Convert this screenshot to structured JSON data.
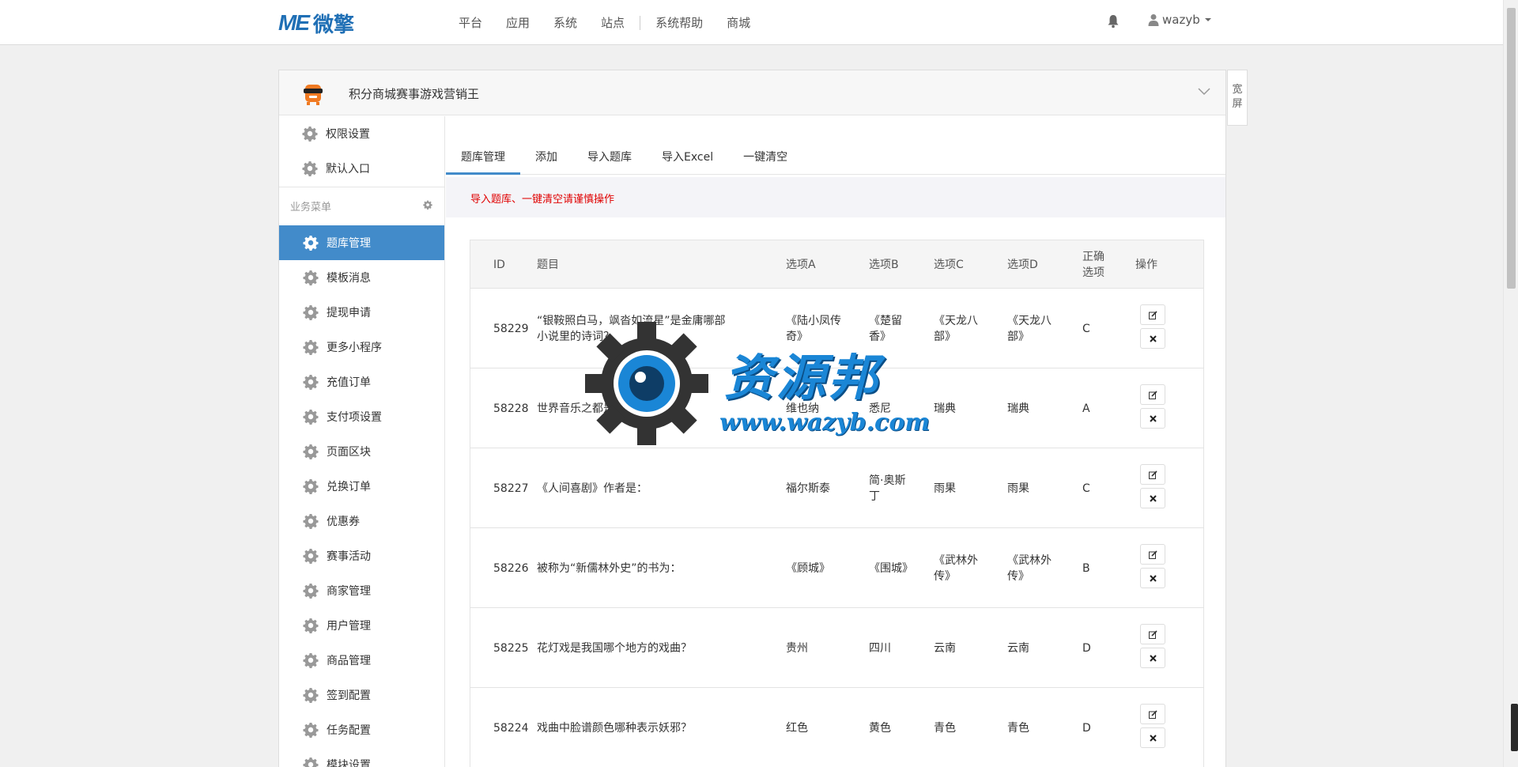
{
  "brand": {
    "logo_mark": "ME",
    "logo_text": "微擎"
  },
  "nav": {
    "items": [
      "平台",
      "应用",
      "系统",
      "站点",
      "系统帮助",
      "商城"
    ]
  },
  "user": {
    "name": "wazyb"
  },
  "app": {
    "title": "积分商城赛事游戏营销王"
  },
  "wide_button": {
    "label": "宽屏"
  },
  "sidebar": {
    "top_items": [
      "权限设置",
      "默认入口"
    ],
    "group_label": "业务菜单",
    "items": [
      "题库管理",
      "模板消息",
      "提现申请",
      "更多小程序",
      "充值订单",
      "支付项设置",
      "页面区块",
      "兑换订单",
      "优惠券",
      "赛事活动",
      "商家管理",
      "用户管理",
      "商品管理",
      "签到配置",
      "任务配置",
      "模块设置"
    ],
    "active_index": 0
  },
  "tabs": [
    "题库管理",
    "添加",
    "导入题库",
    "导入Excel",
    "一键清空"
  ],
  "notice": "导入题库、一键清空请谨慎操作",
  "table": {
    "headers": {
      "id": "ID",
      "question": "题目",
      "a": "选项A",
      "b": "选项B",
      "c": "选项C",
      "d": "选项D",
      "right": "正确选项",
      "ops": "操作"
    },
    "rows": [
      {
        "id": "58229",
        "question": "“银鞍照白马，飒沓如流星”是金庸哪部小说里的诗词？",
        "a": "《陆小凤传奇》",
        "b": "《楚留香》",
        "c": "《天龙八部》",
        "d": "《天龙八部》",
        "right": "C"
      },
      {
        "id": "58228",
        "question": "世界音乐之都是：",
        "a": "维也纳",
        "b": "悉尼",
        "c": "瑞典",
        "d": "瑞典",
        "right": "A"
      },
      {
        "id": "58227",
        "question": "《人间喜剧》作者是：",
        "a": "福尔斯泰",
        "b": "简·奥斯丁",
        "c": "雨果",
        "d": "雨果",
        "right": "C"
      },
      {
        "id": "58226",
        "question": "被称为“新儒林外史”的书为：",
        "a": "《顾城》",
        "b": "《围城》",
        "c": "《武林外传》",
        "d": "《武林外传》",
        "right": "B"
      },
      {
        "id": "58225",
        "question": "花灯戏是我国哪个地方的戏曲？",
        "a": "贵州",
        "b": "四川",
        "c": "云南",
        "d": "云南",
        "right": "D"
      },
      {
        "id": "58224",
        "question": "戏曲中脸谱颜色哪种表示妖邪？",
        "a": "红色",
        "b": "黄色",
        "c": "青色",
        "d": "青色",
        "right": "D"
      }
    ]
  },
  "watermark": {
    "cn": "资源邦",
    "url": "www.wazyb.com"
  },
  "colors": {
    "accent": "#428bca",
    "warning": "#e00000",
    "brand": "#1f6fb5"
  }
}
